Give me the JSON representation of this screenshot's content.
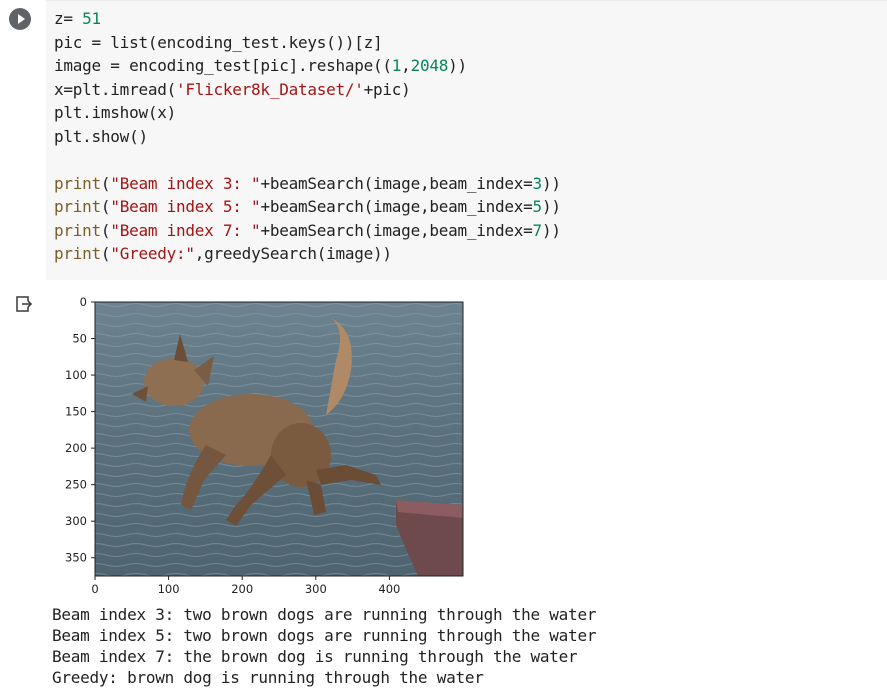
{
  "cell": {
    "code_lines": [
      [
        {
          "t": "z= ",
          "c": "plain"
        },
        {
          "t": "51",
          "c": "num"
        }
      ],
      [
        {
          "t": "pic = list(encoding_test.keys())[z]",
          "c": "plain"
        }
      ],
      [
        {
          "t": "image = encoding_test[pic].reshape((",
          "c": "plain"
        },
        {
          "t": "1",
          "c": "num"
        },
        {
          "t": ",",
          "c": "plain"
        },
        {
          "t": "2048",
          "c": "num"
        },
        {
          "t": "))",
          "c": "plain"
        }
      ],
      [
        {
          "t": "x=plt.imread(",
          "c": "plain"
        },
        {
          "t": "'Flicker8k_Dataset/'",
          "c": "str"
        },
        {
          "t": "+pic)",
          "c": "plain"
        }
      ],
      [
        {
          "t": "plt.imshow(x)",
          "c": "plain"
        }
      ],
      [
        {
          "t": "plt.show()",
          "c": "plain"
        }
      ],
      [
        {
          "t": "",
          "c": "plain"
        }
      ],
      [
        {
          "t": "print",
          "c": "fn"
        },
        {
          "t": "(",
          "c": "plain"
        },
        {
          "t": "\"Beam index 3: \"",
          "c": "str"
        },
        {
          "t": "+beamSearch(image,beam_index=",
          "c": "plain"
        },
        {
          "t": "3",
          "c": "num"
        },
        {
          "t": "))",
          "c": "plain"
        }
      ],
      [
        {
          "t": "print",
          "c": "fn"
        },
        {
          "t": "(",
          "c": "plain"
        },
        {
          "t": "\"Beam index 5: \"",
          "c": "str"
        },
        {
          "t": "+beamSearch(image,beam_index=",
          "c": "plain"
        },
        {
          "t": "5",
          "c": "num"
        },
        {
          "t": "))",
          "c": "plain"
        }
      ],
      [
        {
          "t": "print",
          "c": "fn"
        },
        {
          "t": "(",
          "c": "plain"
        },
        {
          "t": "\"Beam index 7: \"",
          "c": "str"
        },
        {
          "t": "+beamSearch(image,beam_index=",
          "c": "plain"
        },
        {
          "t": "7",
          "c": "num"
        },
        {
          "t": "))",
          "c": "plain"
        }
      ],
      [
        {
          "t": "print",
          "c": "fn"
        },
        {
          "t": "(",
          "c": "plain"
        },
        {
          "t": "\"Greedy:\"",
          "c": "str"
        },
        {
          "t": ",greedySearch(image))",
          "c": "plain"
        }
      ]
    ]
  },
  "plot": {
    "y_ticks": [
      "0",
      "50",
      "100",
      "150",
      "200",
      "250",
      "300",
      "350"
    ],
    "x_ticks": [
      "0",
      "100",
      "200",
      "300",
      "400"
    ],
    "image_desc_icon": "dog-photo",
    "colors": {
      "water": "#5f7480",
      "dog": "#8a6a4e"
    }
  },
  "output_lines": [
    "Beam index 3: two brown dogs are running through the water",
    "Beam index 5: two brown dogs are running through the water",
    "Beam index 7: the brown dog is running through the water",
    "Greedy: brown dog is running through the water"
  ]
}
